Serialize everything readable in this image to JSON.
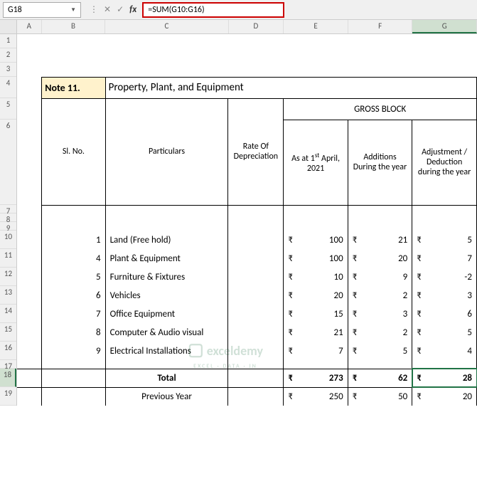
{
  "name_box": "G18",
  "formula": "=SUM(G10:G16)",
  "columns": [
    "A",
    "B",
    "C",
    "D",
    "E",
    "F",
    "G"
  ],
  "row_labels": [
    "1",
    "2",
    "3",
    "4",
    "5",
    "6",
    "7",
    "8",
    "9",
    "10",
    "11",
    "12",
    "13",
    "14",
    "15",
    "16",
    "17",
    "18",
    "19"
  ],
  "note_label": "Note 11.",
  "title": "Property, Plant, and Equipment",
  "headers": {
    "slno": "Sl. No.",
    "particulars": "Particulars",
    "rate": "Rate Of Depreciation",
    "gross_block": "GROSS BLOCK",
    "as_at_pre": "As at 1",
    "as_at_sup": "st",
    "as_at_post": " April, 2021",
    "additions": "Additions During the year",
    "adjustment": "Adjustment / Deduction during the year"
  },
  "data_rows": [
    {
      "slno": "1",
      "part": "Land (Free hold)",
      "e": "100",
      "f": "21",
      "g": "5"
    },
    {
      "slno": "4",
      "part": "Plant & Equipment",
      "e": "100",
      "f": "20",
      "g": "7"
    },
    {
      "slno": "5",
      "part": "Furniture & Fixtures",
      "e": "10",
      "f": "9",
      "g": "-2"
    },
    {
      "slno": "6",
      "part": "Vehicles",
      "e": "20",
      "f": "2",
      "g": "3"
    },
    {
      "slno": "7",
      "part": "Office Equipment",
      "e": "15",
      "f": "3",
      "g": "6"
    },
    {
      "slno": "8",
      "part": "Computer & Audio visual",
      "e": "21",
      "f": "2",
      "g": "5"
    },
    {
      "slno": "9",
      "part": "Electrical Installations",
      "e": "7",
      "f": "5",
      "g": "4"
    }
  ],
  "total": {
    "label": "Total",
    "e": "273",
    "f": "62",
    "g": "28"
  },
  "prev": {
    "label": "Previous Year",
    "e": "250",
    "f": "50",
    "g": "20"
  },
  "watermark": {
    "name": "exceldemy",
    "sub": "EXCEL · DATA · IN"
  }
}
